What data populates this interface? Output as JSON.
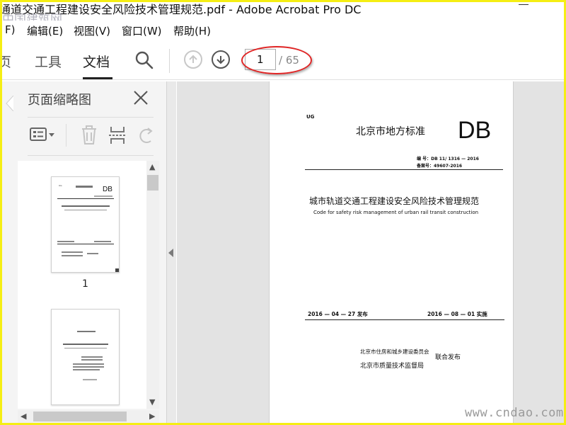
{
  "window": {
    "title": "通道交通工程建设安全风险技术管理规范.pdf - Adobe Acrobat Pro DC",
    "title_visible": "通道交通工程建设安全风险技术管理规范.pdf - Adobe Acrobat Pro DC",
    "title_overlay": "中国建筑网",
    "minimize_icon": "minimize-icon"
  },
  "menu": {
    "items": [
      "F)",
      "编辑(E)",
      "视图(V)",
      "窗口(W)",
      "帮助(H)"
    ]
  },
  "toolbar": {
    "tabs": [
      "页",
      "工具",
      "文档"
    ],
    "active_tab": "文档",
    "search_icon": "search-icon",
    "prev_page_icon": "arrow-up-circle-icon",
    "next_page_icon": "arrow-down-circle-icon",
    "page_current": "1",
    "page_total": "/ 65",
    "highlight_color": "#e02424"
  },
  "left_panel": {
    "title": "页面缩略图",
    "close_icon": "close-icon",
    "tools": [
      "options-menu-icon",
      "delete-icon",
      "insert-page-icon",
      "rotate-icon"
    ],
    "thumbnails": [
      {
        "label": "1"
      },
      {
        "label": ""
      }
    ]
  },
  "document": {
    "ug": "UG",
    "header": "北京市地方标准",
    "db": "DB",
    "code_line1": "编  号：DB 11/ 1316 — 2016",
    "code_line2": "备案号：49607-2016",
    "title_cn": "城市轨道交通工程建设安全风险技术管理规范",
    "title_en": "Code for safety risk management of urban rail transit construction",
    "issue_date": "2016 — 04 — 27 发布",
    "impl_date": "2016 — 08 — 01 实施",
    "issuer1": "北京市住房和城乡建设委员会",
    "issuer2": "北京市质量技术监督局",
    "joint": "联合发布"
  },
  "watermark": "www.cndao.com"
}
